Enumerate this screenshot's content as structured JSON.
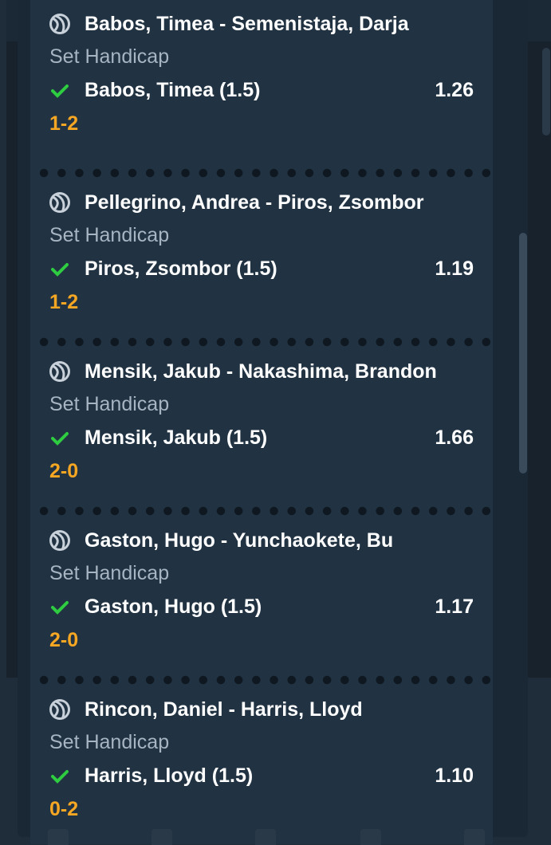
{
  "cards": [
    {
      "match": "Babos, Timea - Semenistaja, Darja",
      "market": "Set Handicap",
      "selection": "Babos, Timea (1.5)",
      "odds": "1.26",
      "score": "1-2",
      "sport_icon": "tennis-ball-icon",
      "status_icon": "check-icon"
    },
    {
      "match": "Pellegrino, Andrea - Piros, Zsombor",
      "market": "Set Handicap",
      "selection": "Piros, Zsombor (1.5)",
      "odds": "1.19",
      "score": "1-2",
      "sport_icon": "tennis-ball-icon",
      "status_icon": "check-icon"
    },
    {
      "match": "Mensik, Jakub - Nakashima, Brandon",
      "market": "Set Handicap",
      "selection": "Mensik, Jakub (1.5)",
      "odds": "1.66",
      "score": "2-0",
      "sport_icon": "tennis-ball-icon",
      "status_icon": "check-icon"
    },
    {
      "match": "Gaston, Hugo - Yunchaokete, Bu",
      "market": "Set Handicap",
      "selection": "Gaston, Hugo (1.5)",
      "odds": "1.17",
      "score": "2-0",
      "sport_icon": "tennis-ball-icon",
      "status_icon": "check-icon"
    },
    {
      "match": "Rincon, Daniel - Harris, Lloyd",
      "market": "Set Handicap",
      "selection": "Harris, Lloyd (1.5)",
      "odds": "1.10",
      "score": "0-2",
      "sport_icon": "tennis-ball-icon",
      "status_icon": "check-icon"
    }
  ],
  "colors": {
    "panel": "#213343",
    "title": "#ffffff",
    "market": "#a7b4c2",
    "score": "#f5a623",
    "check": "#2ecc40"
  }
}
